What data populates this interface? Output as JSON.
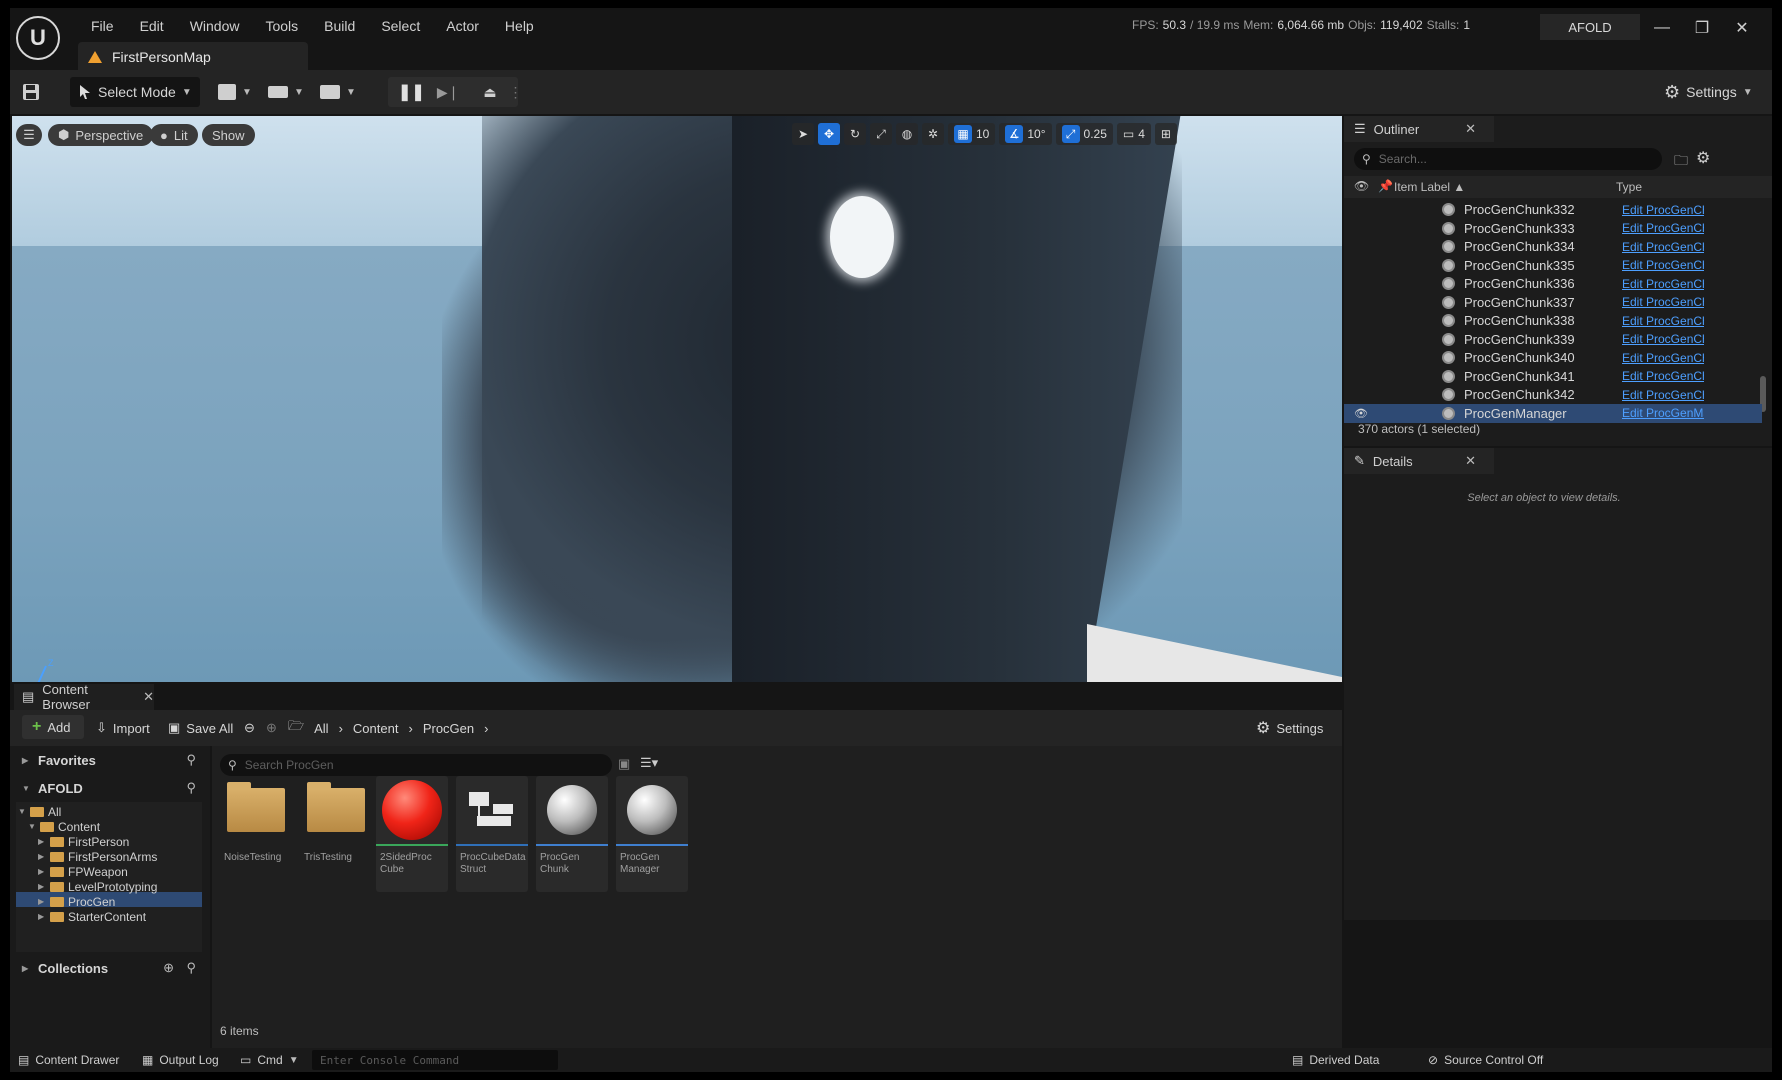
{
  "app": {
    "logo": "U",
    "project_name": "AFOLD",
    "menu": [
      "File",
      "Edit",
      "Window",
      "Tools",
      "Build",
      "Select",
      "Actor",
      "Help"
    ],
    "map_tab": "FirstPersonMap",
    "stats": {
      "fps_label": "FPS:",
      "fps": "50.3",
      "ms": "/ 19.9 ms",
      "mem_label": "Mem:",
      "mem": "6,064.66 mb",
      "objs_label": "Objs:",
      "objs": "119,402",
      "stalls_label": "Stalls:",
      "stalls": "1"
    }
  },
  "toolbar": {
    "select_mode": "Select Mode",
    "settings": "Settings"
  },
  "viewport": {
    "perspective": "Perspective",
    "lit": "Lit",
    "show": "Show",
    "grid_snap": "10",
    "rot_snap": "10°",
    "scale_snap": "0.25",
    "camera_speed": "4"
  },
  "outliner": {
    "title": "Outliner",
    "search_placeholder": "Search...",
    "col_label": "Item Label ▲",
    "col_type": "Type",
    "rows": [
      {
        "label": "ProcGenChunk332",
        "type": "Edit ProcGenCh"
      },
      {
        "label": "ProcGenChunk333",
        "type": "Edit ProcGenCh"
      },
      {
        "label": "ProcGenChunk334",
        "type": "Edit ProcGenCh"
      },
      {
        "label": "ProcGenChunk335",
        "type": "Edit ProcGenCh"
      },
      {
        "label": "ProcGenChunk336",
        "type": "Edit ProcGenCh"
      },
      {
        "label": "ProcGenChunk337",
        "type": "Edit ProcGenCh"
      },
      {
        "label": "ProcGenChunk338",
        "type": "Edit ProcGenCh"
      },
      {
        "label": "ProcGenChunk339",
        "type": "Edit ProcGenCh"
      },
      {
        "label": "ProcGenChunk340",
        "type": "Edit ProcGenCh"
      },
      {
        "label": "ProcGenChunk341",
        "type": "Edit ProcGenCh"
      },
      {
        "label": "ProcGenChunk342",
        "type": "Edit ProcGenCh"
      },
      {
        "label": "ProcGenManager",
        "type": "Edit ProcGenMa"
      }
    ],
    "footer": "370 actors (1 selected)"
  },
  "details": {
    "title": "Details",
    "empty_message": "Select an object to view details."
  },
  "content_browser": {
    "tab": "Content Browser",
    "add": "Add",
    "import": "Import",
    "save_all": "Save All",
    "path": [
      "All",
      "Content",
      "ProcGen"
    ],
    "settings": "Settings",
    "favorites": "Favorites",
    "project": "AFOLD",
    "tree": [
      "All",
      "Content",
      "FirstPerson",
      "FirstPersonArms",
      "FPWeapon",
      "LevelPrototyping",
      "ProcGen",
      "StarterContent"
    ],
    "collections": "Collections",
    "search_placeholder": "Search ProcGen",
    "items": [
      {
        "name": "NoiseTesting",
        "kind": "folder"
      },
      {
        "name": "TrisTesting",
        "kind": "folder"
      },
      {
        "name": "2SidedProc Cube",
        "kind": "material",
        "bar_color": "#3aa65a"
      },
      {
        "name": "ProcCubeData Struct",
        "kind": "struct",
        "bar_color": "#2f6fb8"
      },
      {
        "name": "ProcGen Chunk",
        "kind": "blueprint",
        "bar_color": "#3f7fcf"
      },
      {
        "name": "ProcGen Manager",
        "kind": "blueprint",
        "bar_color": "#3f7fcf"
      }
    ],
    "item_count": "6 items"
  },
  "statusbar": {
    "content_drawer": "Content Drawer",
    "output_log": "Output Log",
    "cmd": "Cmd",
    "console_placeholder": "Enter Console Command",
    "derived_data": "Derived Data",
    "source_control": "Source Control Off"
  }
}
